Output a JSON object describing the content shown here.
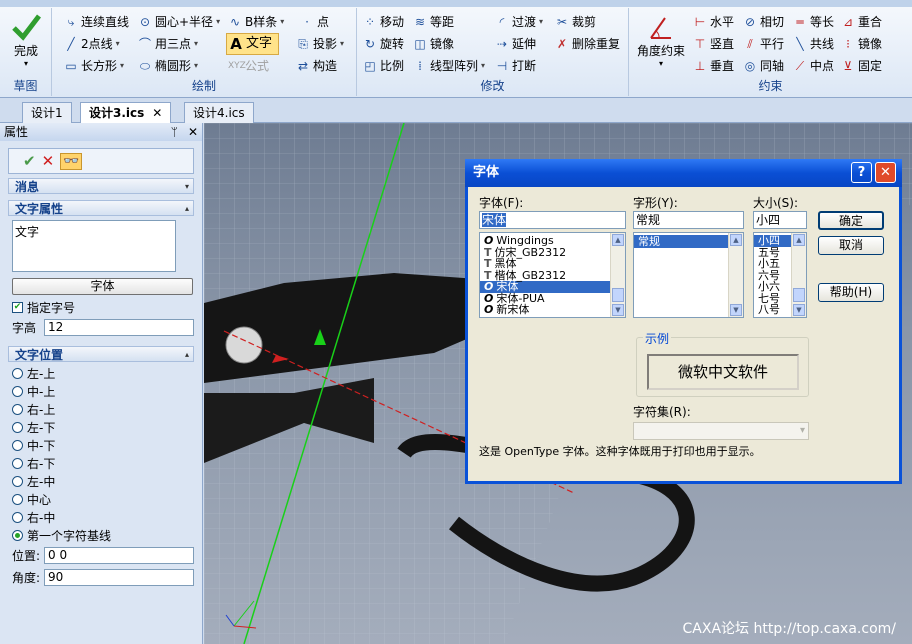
{
  "ribbon": {
    "complete_label": "完成",
    "sketch_group": "草图",
    "draw_group": "绘制",
    "modify_group": "修改",
    "constraint_group": "约束",
    "draw": {
      "chain_line": "连续直线",
      "two_point": "2点线",
      "rectangle": "长方形",
      "circle_center_radius": "圆心+半径",
      "three_point": "用三点",
      "ellipse": "椭圆形",
      "bspline": "B样条",
      "point": "点",
      "text": "文字",
      "formula": "公式"
    },
    "modify": {
      "move": "移动",
      "rotate": "旋转",
      "scale": "比例",
      "equidistant": "等距",
      "mirror": "镜像",
      "linear_array": "线型阵列",
      "project": "投影",
      "construct": "构造",
      "transition": "过渡",
      "extend": "延伸",
      "break": "打断",
      "trim": "裁剪",
      "delete_overlap": "删除重复"
    },
    "constraint": {
      "angle_constraint": "角度约束",
      "horizontal": "水平",
      "vertical": "竖直",
      "perpendicular": "垂直",
      "tangent": "相切",
      "parallel": "平行",
      "concentric": "同轴",
      "equal_length": "等长",
      "collinear": "共线",
      "midpoint": "中点",
      "coincident": "重合",
      "mirror": "镜像",
      "fixed": "固定"
    }
  },
  "tabs": [
    {
      "label": "设计1"
    },
    {
      "label": "设计3.ics",
      "active": true
    },
    {
      "label": "设计4.ics"
    }
  ],
  "panel": {
    "title": "属性",
    "pin": "ᛘ",
    "close": "✕",
    "message_section": "消息",
    "text_attr_section": "文字属性",
    "text_value": "文字",
    "font_button": "字体",
    "specify_size_label": "指定字号",
    "specify_size_checked": true,
    "height_label": "字高",
    "height_value": "12",
    "text_pos_section": "文字位置",
    "positions": [
      "左-上",
      "中-上",
      "右-上",
      "左-下",
      "中-下",
      "右-下",
      "左-中",
      "中心",
      "右-中",
      "第一个字符基线"
    ],
    "selected_position": "第一个字符基线",
    "position_label": "位置:",
    "position_value": "0 0",
    "angle_label": "角度:",
    "angle_value": "90"
  },
  "dialog": {
    "title": "字体",
    "help_btn": "?",
    "close_btn": "✕",
    "font_label": "字体(F):",
    "style_label": "字形(Y):",
    "size_label": "大小(S):",
    "font_value": "宋体",
    "style_value": "常规",
    "size_value": "小四",
    "fonts": [
      {
        "name": "Wingdings",
        "icon": "O"
      },
      {
        "name": "仿宋_GB2312",
        "icon": "T"
      },
      {
        "name": "黑体",
        "icon": "T"
      },
      {
        "name": "楷体_GB2312",
        "icon": "T"
      },
      {
        "name": "宋体",
        "icon": "O",
        "selected": true
      },
      {
        "name": "宋体-PUA",
        "icon": "O"
      },
      {
        "name": "新宋体",
        "icon": "O"
      }
    ],
    "styles": [
      {
        "name": "常规",
        "selected": true
      }
    ],
    "sizes": [
      {
        "name": "小四",
        "selected": true
      },
      {
        "name": "五号"
      },
      {
        "name": "小五"
      },
      {
        "name": "六号"
      },
      {
        "name": "小六"
      },
      {
        "name": "七号"
      },
      {
        "name": "八号"
      }
    ],
    "ok": "确定",
    "cancel": "取消",
    "help": "帮助(H)",
    "sample_label": "示例",
    "sample_text": "微软中文软件",
    "charset_label": "字符集(R):",
    "info_text": "这是 OpenType 字体。这种字体既用于打印也用于显示。"
  },
  "viewport": {
    "watermark": "CAXA论坛 http://top.caxa.com/"
  }
}
